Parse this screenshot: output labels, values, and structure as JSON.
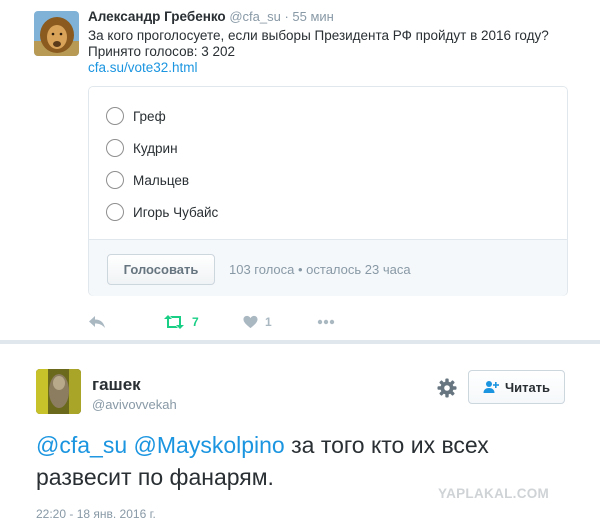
{
  "tweet1": {
    "author_name": "Александр Гребенко",
    "author_handle": "@cfa_su",
    "dot": "·",
    "time": "55 мин",
    "text_line1": "За кого проголосуете, если выборы Президента РФ пройдут в 2016 году?",
    "text_line2": "Принято голосов: 3 202",
    "link": "cfa.su/vote32.html",
    "poll": {
      "options": [
        "Греф",
        "Кудрин",
        "Мальцев",
        "Игорь Чубайс"
      ],
      "vote_button": "Голосовать",
      "stats": "103 голоса • осталось 23 часа"
    },
    "actions": {
      "reply_icon": "reply-icon",
      "retweet_icon": "retweet-icon",
      "retweet_count": "7",
      "like_icon": "heart-icon",
      "like_count": "1",
      "more_icon": "more-icon"
    }
  },
  "tweet2": {
    "author_name": "гашек",
    "author_handle": "@avivovvekah",
    "follow_button": "Читать",
    "mention1": "@cfa_su",
    "mention2": "@Mayskolpino",
    "text_rest": " за того кто их всех развесит по фанарям.",
    "timestamp": "22:20 - 18 янв. 2016 г."
  },
  "watermark": "YAPLAKAL.COM",
  "colors": {
    "link": "#1b95e0",
    "retweet_green": "#19cf86",
    "muted": "#8899a6",
    "text": "#292f33"
  }
}
